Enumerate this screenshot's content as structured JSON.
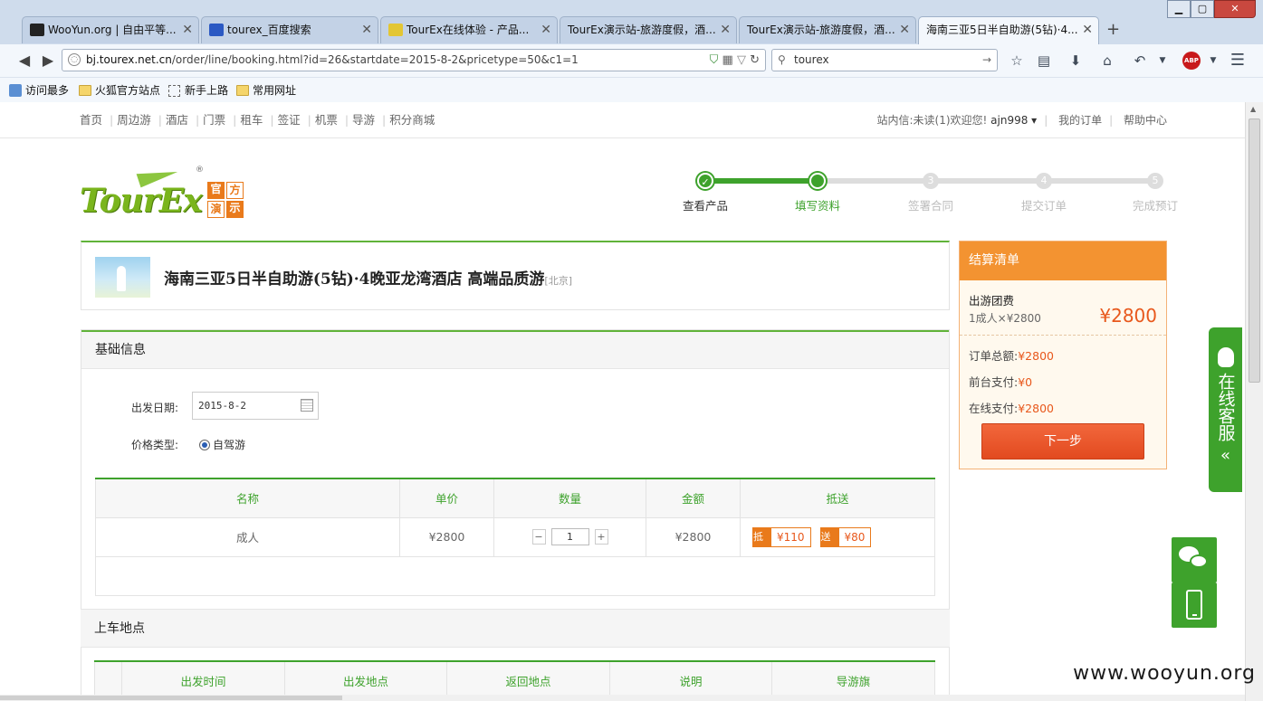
{
  "browser": {
    "tabs": [
      {
        "label": "WooYun.org | 自由平等...",
        "favcolor": "#222222"
      },
      {
        "label": "tourex_百度搜索",
        "favcolor": "#2b59c3"
      },
      {
        "label": "TourEx在线体验 - 产品...",
        "favcolor": "#e3c633"
      },
      {
        "label": "TourEx演示站-旅游度假，酒...",
        "favcolor": ""
      },
      {
        "label": "TourEx演示站-旅游度假，酒...",
        "favcolor": ""
      },
      {
        "label": "海南三亚5日半自助游(5钻)·4...",
        "favcolor": "",
        "active": true
      }
    ],
    "url_host": "bj.tourex.net.cn",
    "url_path": "/order/line/booking.html?id=26&startdate=2015-8-2&pricetype=50&c1=1",
    "search_value": "tourex",
    "abp_label": "ABP",
    "bookmarks": [
      "访问最多",
      "火狐官方站点",
      "新手上路",
      "常用网址"
    ]
  },
  "site": {
    "nav": [
      "首页",
      "周边游",
      "酒店",
      "门票",
      "租车",
      "签证",
      "机票",
      "导游",
      "积分商城"
    ],
    "msg": "站内信:未读(1)",
    "welcome": "欢迎您!",
    "user": "ajn998 ▾",
    "my_orders": "我的订单",
    "help": "帮助中心",
    "logo_text": "TourEx",
    "logo_badge": [
      "官",
      "方",
      "演",
      "示"
    ],
    "logo_reg": "®"
  },
  "steps": [
    {
      "num": "✓",
      "label": "查看产品",
      "state": "done"
    },
    {
      "num": "",
      "label": "填写资料",
      "state": "current"
    },
    {
      "num": "3",
      "label": "签署合同",
      "state": "todo"
    },
    {
      "num": "4",
      "label": "提交订单",
      "state": "todo"
    },
    {
      "num": "5",
      "label": "完成预订",
      "state": "todo"
    }
  ],
  "product": {
    "title": "海南三亚5日半自助游(5钻)·4晚亚龙湾酒店 高端品质游",
    "city": "[北京]"
  },
  "basic": {
    "heading": "基础信息",
    "date_label": "出发日期:",
    "date_value": "2015-8-2",
    "price_type_label": "价格类型:",
    "price_type_value": "自驾游",
    "table_headers": [
      "名称",
      "单价",
      "数量",
      "金额",
      "抵送"
    ],
    "row": {
      "name": "成人",
      "unit_price": "¥2800",
      "qty": "1",
      "qty_minus": "−",
      "qty_plus": "+",
      "amount": "¥2800",
      "coupon1_key": "抵",
      "coupon1_val": "¥110",
      "coupon2_key": "送",
      "coupon2_val": "¥80"
    }
  },
  "pickup": {
    "heading": "上车地点",
    "headers": [
      "",
      "出发时间",
      "出发地点",
      "返回地点",
      "说明",
      "导游旗"
    ]
  },
  "settle": {
    "heading": "结算清单",
    "item_title": "出游团费",
    "item_desc": "1成人×¥2800",
    "item_total": "¥2800",
    "order_total_label": "订单总额:",
    "order_total": "¥2800",
    "front_label": "前台支付:",
    "front": "¥0",
    "online_label": "在线支付:",
    "online": "¥2800",
    "next_button": "下一步"
  },
  "side": {
    "service": "在线客服",
    "collapse": "«"
  },
  "watermark": "www.wooyun.org"
}
